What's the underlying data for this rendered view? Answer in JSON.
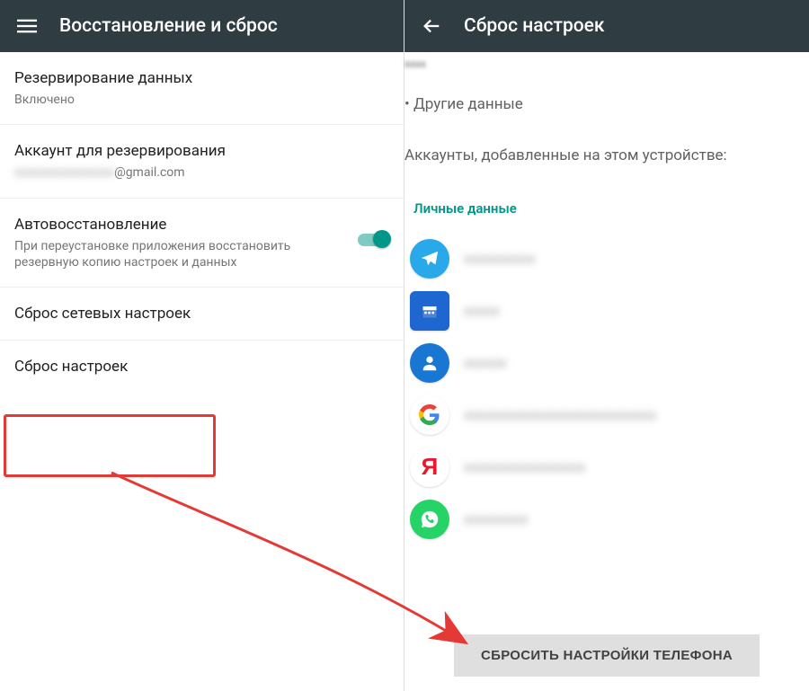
{
  "left": {
    "title": "Восстановление и сброс",
    "items": {
      "backup": {
        "primary": "Резервирование данных",
        "secondary": "Включено"
      },
      "account": {
        "primary": "Аккаунт для резервирования",
        "secondary_suffix": "@gmail.com"
      },
      "autorestore": {
        "primary": "Автовосстановление",
        "secondary": "При переустановке приложения восстановить резервную копию настроек и данных"
      },
      "network_reset": {
        "primary": "Сброс сетевых настроек"
      },
      "factory_reset": {
        "primary": "Сброс настроек"
      }
    }
  },
  "right": {
    "title": "Сброс настроек",
    "bullet": "• Другие данные",
    "accounts_text": "Аккаунты, добавленные на этом устройстве:",
    "section_label": "Личные данные",
    "button": "СБРОСИТЬ НАСТРОЙКИ ТЕЛЕФОНА",
    "accounts": [
      {
        "icon": "telegram",
        "label": "redacted"
      },
      {
        "icon": "calendar",
        "label": "redacted"
      },
      {
        "icon": "contact",
        "label": "redacted"
      },
      {
        "icon": "google",
        "label": "redacted"
      },
      {
        "icon": "yandex",
        "label": "redacted"
      },
      {
        "icon": "whatsapp",
        "label": "redacted"
      }
    ]
  }
}
